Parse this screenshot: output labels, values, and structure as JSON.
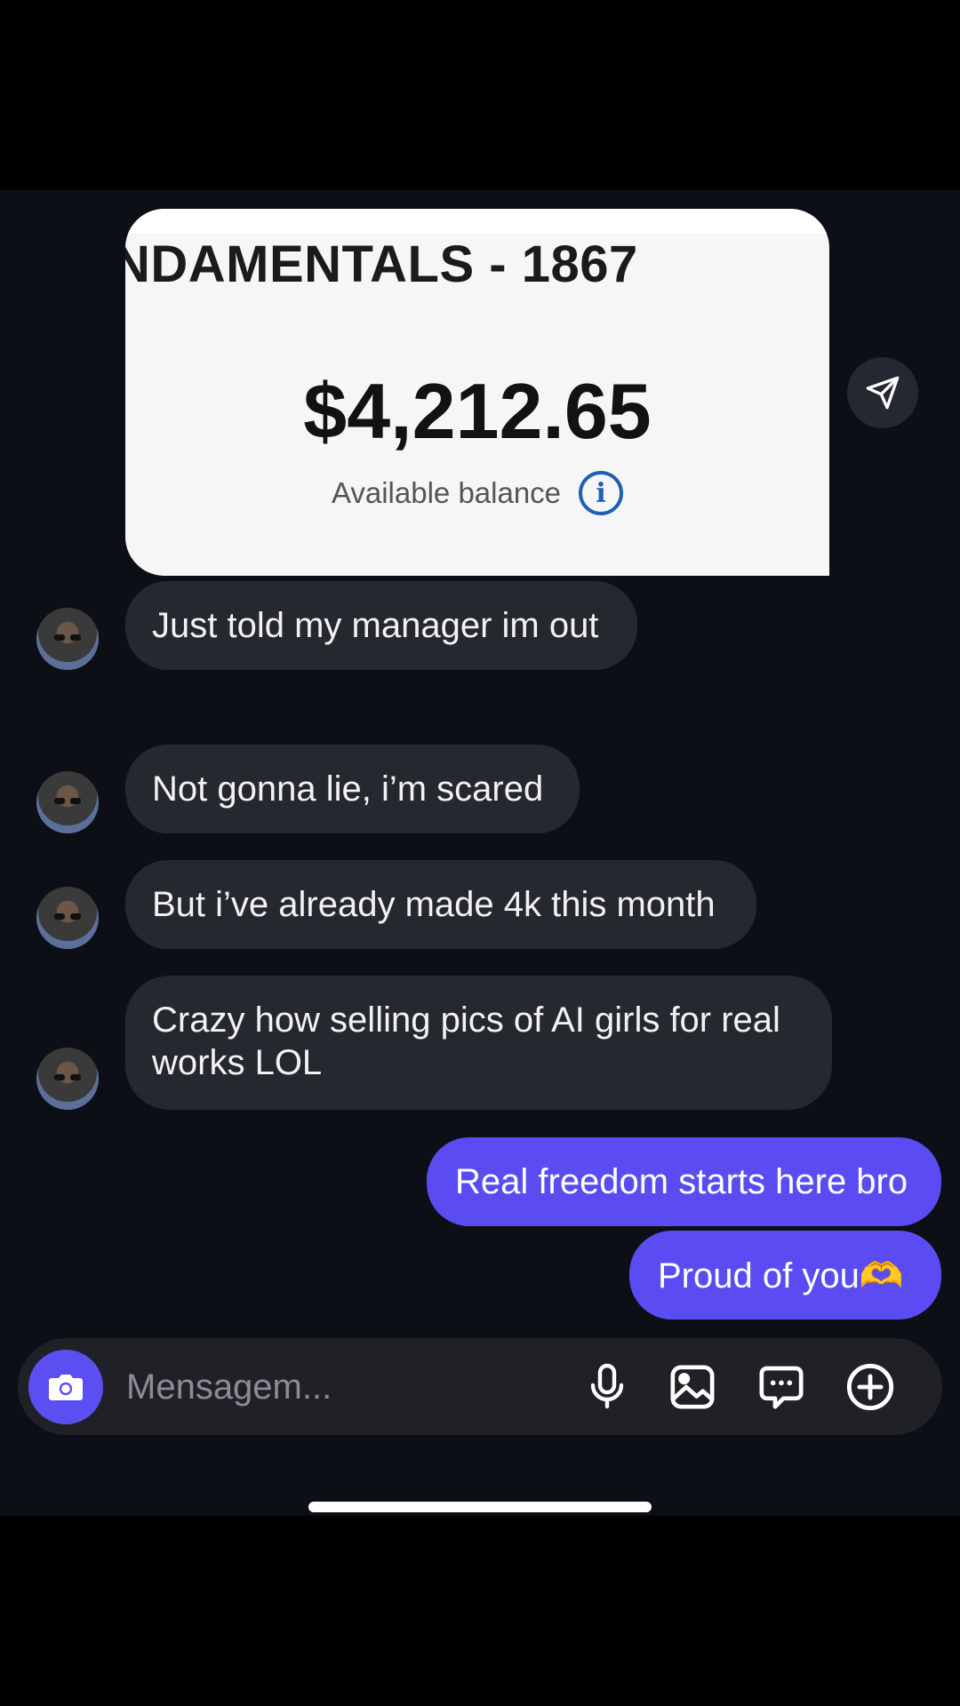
{
  "shared_card": {
    "title": "NDAMENTALS - 1867",
    "amount": "$4,212.65",
    "label": "Available balance"
  },
  "messages": [
    {
      "direction": "incoming",
      "text": "Just told my manager im out"
    },
    {
      "direction": "incoming",
      "text": "Not gonna lie, i’m scared"
    },
    {
      "direction": "incoming",
      "text": "But i’ve already made 4k this month"
    },
    {
      "direction": "incoming",
      "text": "Crazy how selling pics of AI girls for real works LOL"
    },
    {
      "direction": "outgoing",
      "text": "Real freedom starts here bro"
    },
    {
      "direction": "outgoing",
      "text": "Proud of you🫶"
    }
  ],
  "composer": {
    "placeholder": "Mensagem..."
  },
  "icons": {
    "share": "send-icon",
    "info": "info-icon",
    "camera": "camera-icon",
    "mic": "microphone-icon",
    "gallery": "image-icon",
    "sticker": "chat-bubble-icon",
    "more": "plus-circle-icon"
  },
  "colors": {
    "background": "#0c0f15",
    "incoming_bubble": "#262830",
    "outgoing_bubble": "#5a4cf2",
    "accent": "#5c4ff2"
  }
}
